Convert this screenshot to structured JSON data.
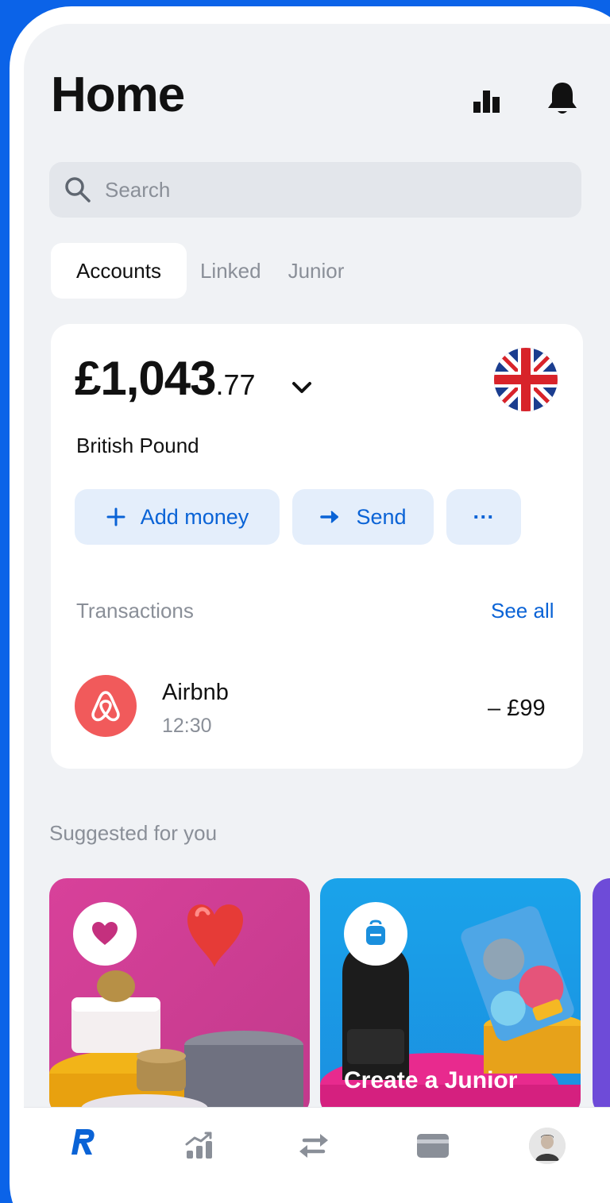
{
  "header": {
    "title": "Home"
  },
  "search": {
    "placeholder": "Search"
  },
  "tabs": [
    {
      "label": "Accounts",
      "active": true
    },
    {
      "label": "Linked",
      "active": false
    },
    {
      "label": "Junior",
      "active": false
    }
  ],
  "account": {
    "balance_main": "£1,043",
    "balance_cents": ".77",
    "currency": "British Pound",
    "flag_icon": "uk-flag-icon",
    "actions": {
      "add_money": "Add money",
      "send": "Send",
      "more": "···"
    }
  },
  "transactions": {
    "label": "Transactions",
    "see_all": "See all",
    "items": [
      {
        "merchant": "Airbnb",
        "time": "12:30",
        "amount": "– £99",
        "icon": "airbnb-logo"
      }
    ]
  },
  "suggested": {
    "label": "Suggested for you",
    "cards": [
      {
        "caption": "",
        "icon": "heart-icon",
        "color": "#d8419a"
      },
      {
        "caption": "Create a Junior",
        "icon": "backpack-icon",
        "color": "#1aa3ea"
      },
      {
        "caption": "",
        "icon": "",
        "color": "#6e4bd8"
      }
    ]
  },
  "nav": [
    {
      "icon": "revolut-logo-icon",
      "active": true
    },
    {
      "icon": "invest-chart-icon",
      "active": false
    },
    {
      "icon": "transfer-arrows-icon",
      "active": false
    },
    {
      "icon": "card-icon",
      "active": false
    },
    {
      "icon": "avatar-icon",
      "active": false
    }
  ],
  "colors": {
    "brand_blue": "#0a63d6",
    "background": "#0b63e8",
    "airbnb": "#f15a5b"
  }
}
